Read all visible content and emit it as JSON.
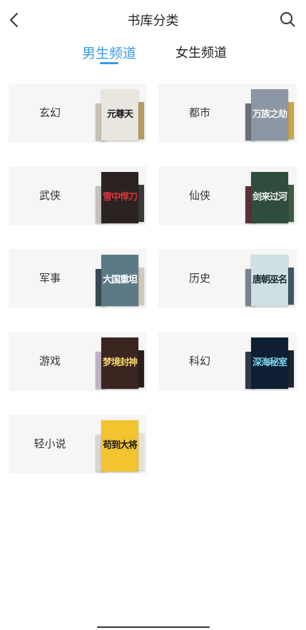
{
  "header": {
    "title": "书库分类",
    "back_icon": "chevron-left-icon",
    "search_icon": "search-icon"
  },
  "tabs": [
    {
      "label": "男生频道",
      "active": true
    },
    {
      "label": "女生频道",
      "active": false
    }
  ],
  "colors": {
    "accent": "#3a9be6",
    "card_bg": "#f6f6f6"
  },
  "categories": [
    {
      "label": "玄幻",
      "cover_title": "元尊天",
      "cover_bg": "#e9e6df",
      "cover_fg": "#1a1a1a",
      "side_l": "#c9c2b5",
      "side_r": "#b89c62"
    },
    {
      "label": "都市",
      "cover_title": "万族之劫",
      "cover_bg": "#8c96a4",
      "cover_fg": "#f3f3f3",
      "side_l": "#6a6f78",
      "side_r": "#c8a84f"
    },
    {
      "label": "武侠",
      "cover_title": "雪中悍刀",
      "cover_bg": "#2a2322",
      "cover_fg": "#d9333a",
      "side_l": "#c4c0bd",
      "side_r": "#3b3a3a"
    },
    {
      "label": "仙侠",
      "cover_title": "剑来过河",
      "cover_bg": "#2e4d3c",
      "cover_fg": "#f0f0f0",
      "side_l": "#5b2f35",
      "side_r": "#3e5b43"
    },
    {
      "label": "军事",
      "cover_title": "大国重坦",
      "cover_bg": "#5c7a86",
      "cover_fg": "#ffffff",
      "side_l": "#3a4952",
      "side_r": "#cfc9bb"
    },
    {
      "label": "历史",
      "cover_title": "唐朝巫名",
      "cover_bg": "#cfe0e2",
      "cover_fg": "#1b2a2f",
      "side_l": "#7c838f",
      "side_r": "#3e5866"
    },
    {
      "label": "游戏",
      "cover_title": "梦境封神",
      "cover_bg": "#3b2520",
      "cover_fg": "#f1d36a",
      "side_l": "#bfb2c4",
      "side_r": "#2a1e1b"
    },
    {
      "label": "科幻",
      "cover_title": "深海秘室",
      "cover_bg": "#0e1f33",
      "cover_fg": "#7dd3f0",
      "side_l": "#2d3a48",
      "side_r": "#1d2430"
    },
    {
      "label": "轻小说",
      "cover_title": "苟到大将",
      "cover_bg": "#f1c430",
      "cover_fg": "#1a1a1a",
      "side_l": "#d8d6cf",
      "side_r": "#e7e2d3"
    }
  ]
}
